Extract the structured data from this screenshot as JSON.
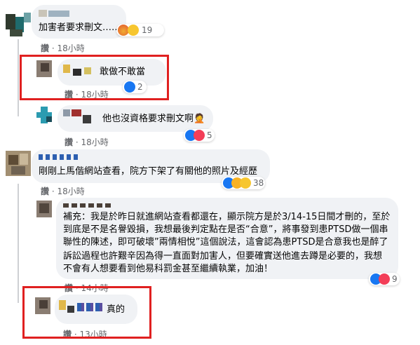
{
  "comments": [
    {
      "text": "加害者要求刪文……",
      "reactions": "19",
      "meta_action": "讚",
      "meta_time": "18小時"
    },
    {
      "text": "敢做不敢當",
      "reactions": "2",
      "meta_action": "讚",
      "meta_time": "18小時"
    },
    {
      "text": "他也沒資格要求刪文啊",
      "emoji": "🤦",
      "reactions": "5",
      "meta_action": "讚",
      "meta_time": "18小時"
    },
    {
      "text": "剛剛上馬偕網站查看，院方下架了有關他的照片及經歷",
      "reactions": "38",
      "meta_action": "讚",
      "meta_time": "18小時"
    },
    {
      "lines": [
        "補充：我是於昨日就進網站查看都還在，顯示院方是於3/14-15日間才刪的，至於",
        "到底是不是名譽毀損，我想最後判定點在是否“合意”，將事發到患PTSD做一個串",
        "聯性的陳述，即可破壞”兩情相悅”這個說法，這會認為患PTSD是合意我也是醉了",
        "訴訟過程也許艱辛因為得一直面對加害人，但要確實送他進去蹲是必要的，我想",
        "不會有人想要看到他易科罰金甚至繼續執業，加油！"
      ],
      "reactions": "9",
      "meta_action": "讚",
      "meta_time": "14小時"
    },
    {
      "text": "真的",
      "meta_action": "讚",
      "meta_time": "13小時"
    }
  ],
  "colors": {
    "bubble": "#f0f2f5",
    "highlight_box": "#e02020",
    "like_blue": "#1877f2",
    "love_red": "#f33e58",
    "haha_yellow": "#f7b125",
    "meta_gray": "#65676b"
  },
  "icons": [
    "like-icon",
    "love-icon",
    "haha-icon",
    "angry-icon",
    "sad-icon",
    "facepalm-emoji"
  ]
}
